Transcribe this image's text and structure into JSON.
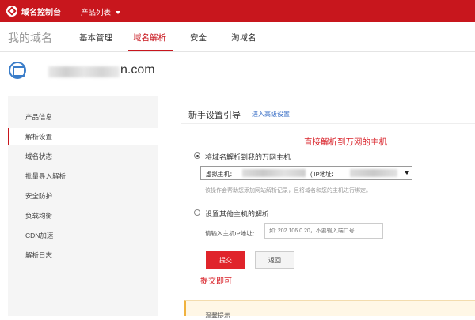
{
  "topbar": {
    "logo_text": "域名控制台",
    "products_menu": "产品列表"
  },
  "navbar": {
    "brand": "我的域名",
    "items": [
      {
        "label": "基本管理"
      },
      {
        "label": "域名解析"
      },
      {
        "label": "安全"
      },
      {
        "label": "淘域名"
      }
    ]
  },
  "domain": {
    "name_visible": "n.com"
  },
  "sidebar": {
    "items": [
      {
        "label": "产品信息"
      },
      {
        "label": "解析设置"
      },
      {
        "label": "域名状态"
      },
      {
        "label": "批量导入解析"
      },
      {
        "label": "安全防护"
      },
      {
        "label": "负载均衡"
      },
      {
        "label": "CDN加速"
      },
      {
        "label": "解析日志"
      }
    ]
  },
  "main": {
    "title": "新手设置引导",
    "advanced_link": "进入高级设置",
    "annotation_top": "直接解析到万网的主机",
    "option1_label": "将域名解析到我的万网主机",
    "select_prefix": "虚拟主机：",
    "select_ip_label": "( IP地址：",
    "hint": "该操作会帮助您添加网站解析记录，且将域名和您的主机进行绑定。",
    "option2_label": "设置其他主机的解析",
    "ip_label": "请输入主机IP地址：",
    "ip_placeholder": "如: 202.106.0.20，不要输入端口号",
    "submit_label": "提交",
    "back_label": "返回",
    "annotation_bottom": "提交即可",
    "tip_text": "温馨提示"
  },
  "colors": {
    "brand_red": "#c8161d",
    "link_blue": "#3a6fc6",
    "annotation_red": "#d9232a"
  }
}
